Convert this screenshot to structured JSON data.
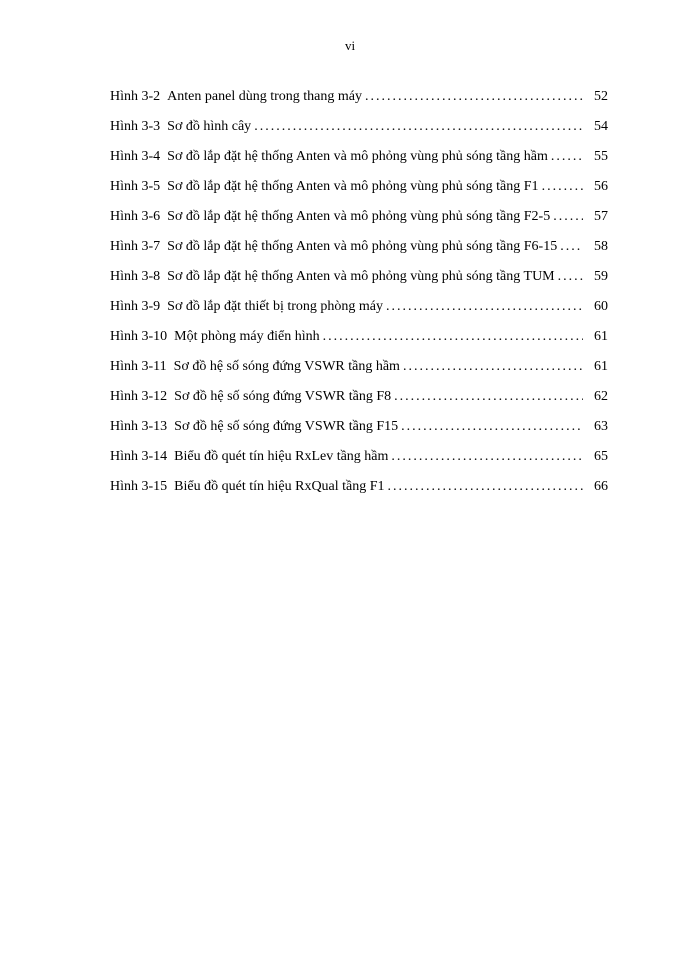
{
  "page_number": "vi",
  "toc_entries": [
    {
      "label": "Hình 3-2",
      "title": "Anten panel dùng trong thang máy",
      "page": "52"
    },
    {
      "label": "Hình 3-3",
      "title": "Sơ đồ hình cây",
      "page": "54"
    },
    {
      "label": "Hình 3-4",
      "title": "Sơ đồ lắp đặt hệ thống Anten và mô phỏng vùng phủ sóng tầng hầm",
      "page": "55"
    },
    {
      "label": "Hình 3-5",
      "title": "Sơ đồ lắp đặt hệ thống Anten và mô phỏng vùng phủ sóng tầng F1",
      "page": "56"
    },
    {
      "label": "Hình 3-6",
      "title": "Sơ đồ lắp đặt hệ thống Anten và mô phỏng vùng phủ sóng tầng F2-5",
      "page": "57"
    },
    {
      "label": "Hình 3-7",
      "title": "Sơ đồ lắp đặt hệ thống Anten và mô phỏng vùng phủ sóng tầng F6-15",
      "page": "58"
    },
    {
      "label": "Hình 3-8",
      "title": "Sơ đồ lắp đặt hệ thống Anten và mô phỏng vùng phủ sóng tầng TUM",
      "page": "59"
    },
    {
      "label": "Hình 3-9",
      "title": "Sơ đồ lắp đặt thiết bị trong phòng máy",
      "page": "60"
    },
    {
      "label": "Hình 3-10",
      "title": "Một phòng máy điển hình",
      "page": "61"
    },
    {
      "label": "Hình 3-11",
      "title": "Sơ đồ hệ số sóng đứng VSWR tầng hầm",
      "page": "61"
    },
    {
      "label": "Hình 3-12",
      "title": "Sơ đồ hệ số sóng đứng VSWR tầng F8",
      "page": "62"
    },
    {
      "label": "Hình 3-13",
      "title": "Sơ đồ hệ số sóng đứng VSWR tầng F15",
      "page": "63"
    },
    {
      "label": "Hình 3-14",
      "title": "Biểu đồ quét tín hiệu RxLev tầng hầm",
      "page": "65"
    },
    {
      "label": "Hình 3-15",
      "title": "Biểu đồ quét tín hiệu RxQual tầng F1",
      "page": "66"
    }
  ]
}
